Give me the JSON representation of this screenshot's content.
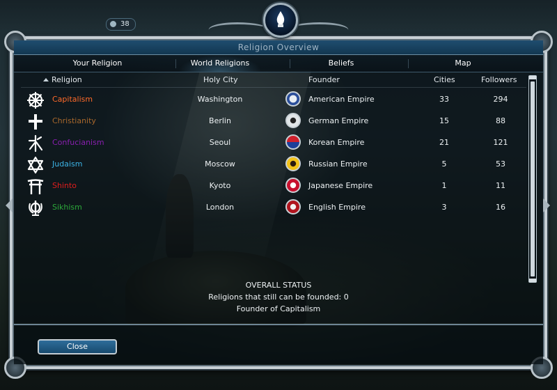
{
  "window": {
    "title": "Religion Overview"
  },
  "hud": {
    "badge_value": "38"
  },
  "tabs": [
    {
      "label": "Your Religion",
      "active": false
    },
    {
      "label": "World Religions",
      "active": true
    },
    {
      "label": "Beliefs",
      "active": false
    },
    {
      "label": "Map",
      "active": false
    }
  ],
  "columns": {
    "religion": "Religion",
    "holy_city": "Holy City",
    "founder": "Founder",
    "cities": "Cities",
    "followers": "Followers"
  },
  "religions": [
    {
      "icon": "dharma-wheel-icon",
      "name": "Capitalism",
      "name_color": "#ff6a2a",
      "holy_city": "Washington",
      "founder_icon": "american-empire-icon",
      "founder": "American Empire",
      "cities": "33",
      "followers": "294"
    },
    {
      "icon": "cross-icon",
      "name": "Christianity",
      "name_color": "#a8682c",
      "holy_city": "Berlin",
      "founder_icon": "german-empire-icon",
      "founder": "German Empire",
      "cities": "15",
      "followers": "88"
    },
    {
      "icon": "confucianism-symbol-icon",
      "name": "Confucianism",
      "name_color": "#8a1fb0",
      "holy_city": "Seoul",
      "founder_icon": "korean-empire-icon",
      "founder": "Korean Empire",
      "cities": "21",
      "followers": "121"
    },
    {
      "icon": "star-of-david-icon",
      "name": "Judaism",
      "name_color": "#3cb4e6",
      "holy_city": "Moscow",
      "founder_icon": "russian-empire-icon",
      "founder": "Russian Empire",
      "cities": "5",
      "followers": "53"
    },
    {
      "icon": "torii-gate-icon",
      "name": "Shinto",
      "name_color": "#e01d1d",
      "holy_city": "Kyoto",
      "founder_icon": "japanese-empire-icon",
      "founder": "Japanese Empire",
      "cities": "1",
      "followers": "11"
    },
    {
      "icon": "khanda-icon",
      "name": "Sikhism",
      "name_color": "#2ca83a",
      "holy_city": "London",
      "founder_icon": "english-empire-icon",
      "founder": "English Empire",
      "cities": "3",
      "followers": "16"
    }
  ],
  "status": {
    "heading": "OVERALL STATUS",
    "line1": "Religions that still can be founded: 0",
    "line2": "Founder of Capitalism"
  },
  "buttons": {
    "close": "Close"
  }
}
